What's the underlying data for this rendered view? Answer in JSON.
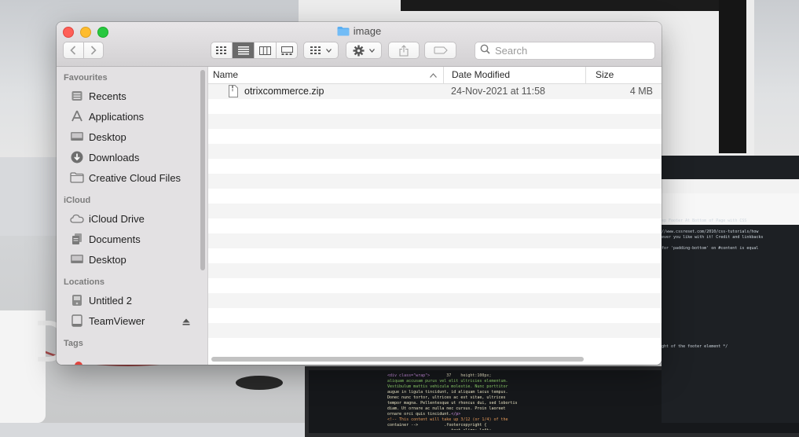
{
  "window": {
    "title": "image"
  },
  "toolbar": {
    "back_icon": "chevron-left-icon",
    "forward_icon": "chevron-right-icon",
    "view_modes": [
      "icon-view-icon",
      "list-view-icon",
      "column-view-icon",
      "gallery-view-icon"
    ],
    "active_view": "list-view-icon",
    "group_icon": "group-grid-icon",
    "action_icon": "gear-icon",
    "share_icon": "share-icon",
    "tag_icon": "tag-icon",
    "search_placeholder": "Search"
  },
  "sidebar": {
    "sections": [
      {
        "title": "Favourites",
        "items": [
          {
            "label": "Recents",
            "icon": "clock-icon"
          },
          {
            "label": "Applications",
            "icon": "applications-icon"
          },
          {
            "label": "Desktop",
            "icon": "desktop-icon"
          },
          {
            "label": "Downloads",
            "icon": "download-icon"
          },
          {
            "label": "Creative Cloud Files",
            "icon": "folder-icon"
          }
        ]
      },
      {
        "title": "iCloud",
        "items": [
          {
            "label": "iCloud Drive",
            "icon": "cloud-icon"
          },
          {
            "label": "Documents",
            "icon": "documents-icon"
          },
          {
            "label": "Desktop",
            "icon": "desktop-icon"
          }
        ]
      },
      {
        "title": "Locations",
        "items": [
          {
            "label": "Untitled 2",
            "icon": "disk-icon"
          },
          {
            "label": "TeamViewer",
            "icon": "drive-icon"
          }
        ]
      },
      {
        "title": "Tags",
        "items": []
      }
    ]
  },
  "list": {
    "columns": {
      "name": "Name",
      "date": "Date Modified",
      "size": "Size"
    },
    "files": [
      {
        "name": "otrixcommerce.zip",
        "date": "24-Nov-2021 at 11:58",
        "size": "4 MB",
        "icon": "zip-file-icon"
      }
    ]
  }
}
